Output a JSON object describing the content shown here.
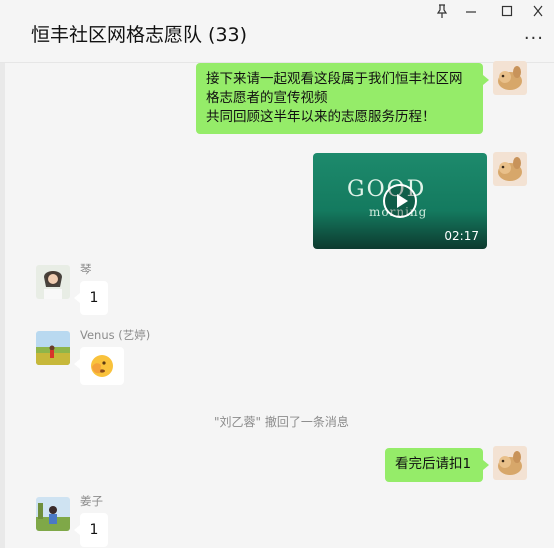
{
  "window": {
    "title": "恒丰社区网格志愿队 (33)",
    "pin_icon": "pin-icon",
    "minimize_icon": "minimize-icon",
    "maximize_icon": "maximize-icon",
    "close_icon": "close-icon",
    "more_icon": "more-icon"
  },
  "messages": {
    "m1": {
      "line1": "接下来请一起观看这段属于我们恒丰社区网",
      "line2": "格志愿者的宣传视频",
      "line3": "共同回顾这半年以来的志愿服务历程！"
    },
    "m2": {
      "video_title": "GOOD",
      "video_subtitle": "morning",
      "duration": "02:17"
    },
    "m3": {
      "sender": "琴",
      "text": "1"
    },
    "m4": {
      "sender": "Venus (艺婷)",
      "emoji": "🫣"
    },
    "m5": {
      "system": "\"刘乙蓉\" 撤回了一条消息"
    },
    "m6": {
      "text": "看完后请扣1"
    },
    "m7": {
      "sender": "姜子",
      "text": "1"
    }
  },
  "colors": {
    "self_bubble": "#95ec69",
    "other_bubble": "#ffffff",
    "background": "#f5f5f5"
  }
}
